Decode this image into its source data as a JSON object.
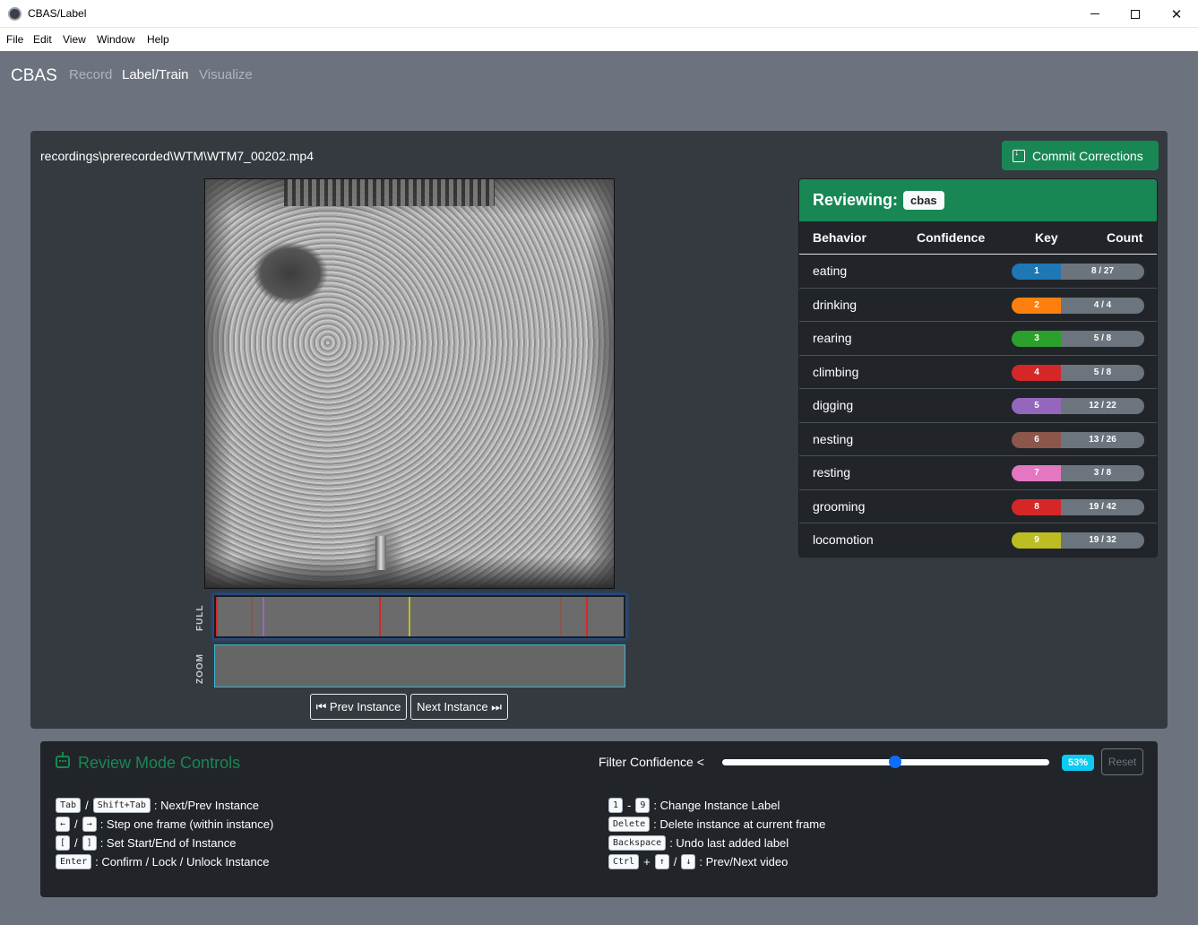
{
  "window": {
    "title": "CBAS/Label"
  },
  "menu": [
    "File",
    "Edit",
    "View",
    "Window",
    "Help"
  ],
  "nav": {
    "brand": "CBAS",
    "links": [
      "Record",
      "Label/Train",
      "Visualize"
    ],
    "active": "Label/Train"
  },
  "main": {
    "filepath": "recordings\\prerecorded\\WTM\\WTM7_00202.mp4",
    "commit_label": "Commit Corrections",
    "timeline_labels": {
      "full": "FULL",
      "zoom": "ZOOM"
    },
    "prev_label": "⏮ Prev Instance",
    "next_label": "Next Instance ⏭"
  },
  "review": {
    "title": "Reviewing:",
    "model": "cbas",
    "headers": [
      "Behavior",
      "Confidence",
      "Key",
      "Count"
    ],
    "rows": [
      {
        "behavior": "eating",
        "key": "1",
        "count": "8 / 27",
        "color": "#1f77b4"
      },
      {
        "behavior": "drinking",
        "key": "2",
        "count": "4 / 4",
        "color": "#ff7f0e"
      },
      {
        "behavior": "rearing",
        "key": "3",
        "count": "5 / 8",
        "color": "#2ca02c"
      },
      {
        "behavior": "climbing",
        "key": "4",
        "count": "5 / 8",
        "color": "#d62728"
      },
      {
        "behavior": "digging",
        "key": "5",
        "count": "12 / 22",
        "color": "#9467bd"
      },
      {
        "behavior": "nesting",
        "key": "6",
        "count": "13 / 26",
        "color": "#8c564b"
      },
      {
        "behavior": "resting",
        "key": "7",
        "count": "3 / 8",
        "color": "#e377c2"
      },
      {
        "behavior": "grooming",
        "key": "8",
        "count": "19 / 42",
        "color": "#d62728"
      },
      {
        "behavior": "locomotion",
        "key": "9",
        "count": "19 / 32",
        "color": "#bcbd22"
      }
    ]
  },
  "controls": {
    "title": "Review Mode Controls",
    "filter_label": "Filter Confidence <",
    "filter_value": 0.53,
    "filter_pct": "53%",
    "reset_label": "Reset",
    "hotkeys_left": [
      {
        "keys": [
          "Tab",
          "/",
          "Shift+Tab"
        ],
        "desc": ": Next/Prev Instance"
      },
      {
        "keys": [
          "←",
          "/",
          "→"
        ],
        "desc": ": Step one frame (within instance)"
      },
      {
        "keys": [
          "[",
          "/",
          "]"
        ],
        "desc": ": Set Start/End of Instance"
      },
      {
        "keys": [
          "Enter"
        ],
        "desc": ": Confirm / Lock / Unlock Instance"
      }
    ],
    "hotkeys_right": [
      {
        "keys": [
          "1",
          "-",
          "9"
        ],
        "desc": ": Change Instance Label"
      },
      {
        "keys": [
          "Delete"
        ],
        "desc": ": Delete instance at current frame"
      },
      {
        "keys": [
          "Backspace"
        ],
        "desc": ": Undo last added label"
      },
      {
        "keys": [
          "Ctrl",
          "+",
          "↑",
          "/",
          "↓"
        ],
        "desc": ": Prev/Next video"
      }
    ]
  }
}
